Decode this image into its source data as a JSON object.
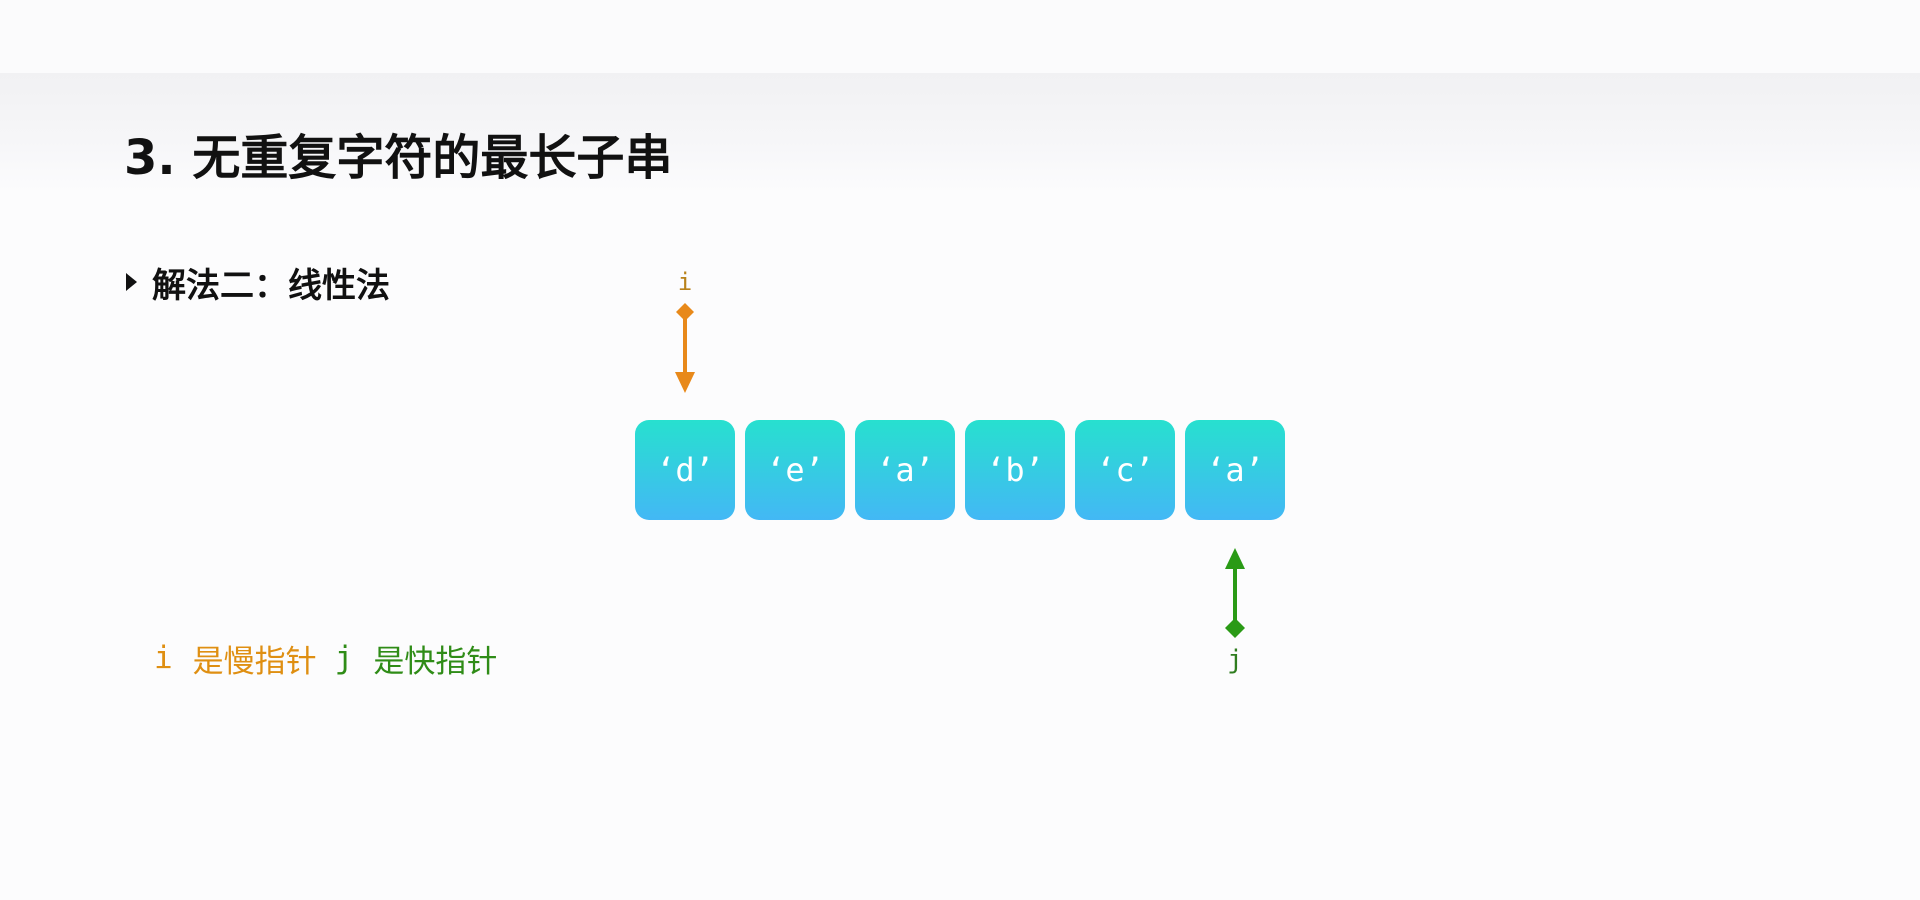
{
  "title": "3. 无重复字符的最长子串",
  "section": {
    "label": "解法二：线性法"
  },
  "array": {
    "cells": [
      "‘d’",
      "‘e’",
      "‘a’",
      "‘b’",
      "‘c’",
      "‘a’"
    ]
  },
  "pointers": {
    "slow": {
      "label": "i",
      "index": 0,
      "color": "#e8891a"
    },
    "fast": {
      "label": "j",
      "index": 5,
      "color": "#2a9a16"
    }
  },
  "legend": {
    "slow_var": "i",
    "slow_text": "是慢指针",
    "fast_var": "j",
    "fast_text": "是快指针"
  },
  "colors": {
    "cell_top": "#27e0cf",
    "cell_bottom": "#43b8f5",
    "cell_text": "#ffffff"
  }
}
